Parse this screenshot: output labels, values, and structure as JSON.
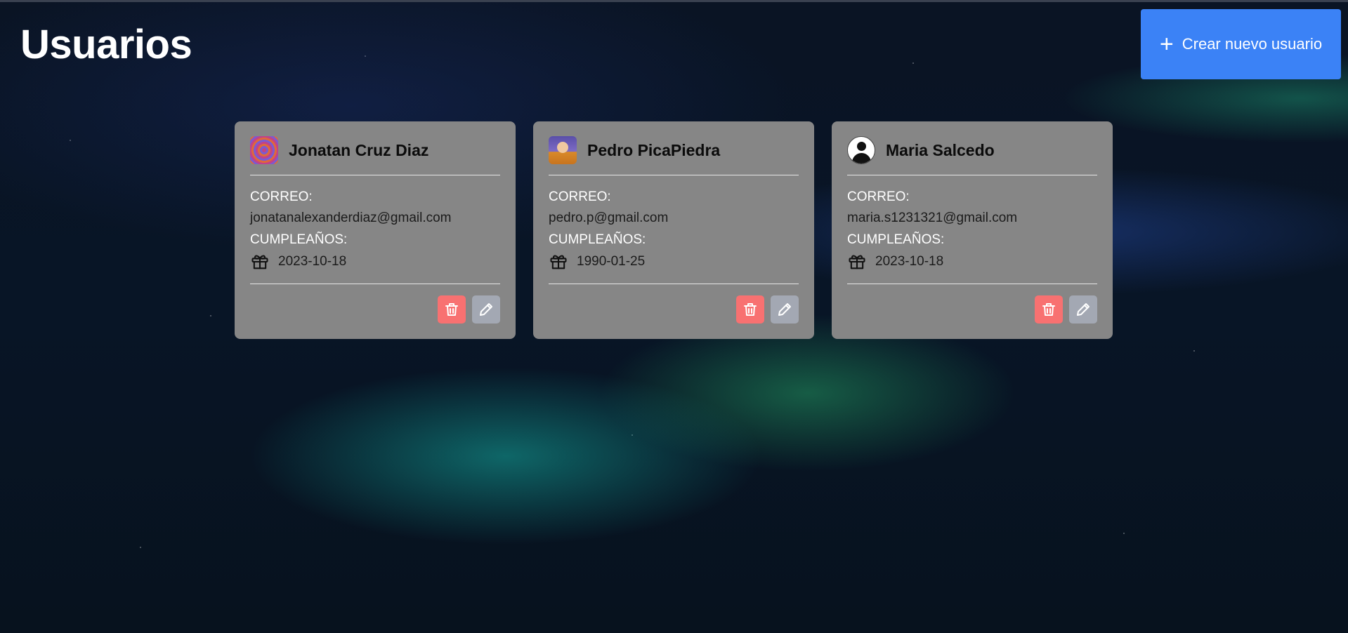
{
  "header": {
    "title": "Usuarios",
    "create_button_label": "Crear nuevo usuario"
  },
  "labels": {
    "email": "CORREO:",
    "birthday": "CUMPLEAÑOS:"
  },
  "users": [
    {
      "name": "Jonatan Cruz Diaz",
      "email": "jonatanalexanderdiaz@gmail.com",
      "birthday": "2023-10-18",
      "avatar": "psychedelic-pattern-avatar"
    },
    {
      "name": "Pedro PicaPiedra",
      "email": "pedro.p@gmail.com",
      "birthday": "1990-01-25",
      "avatar": "cartoon-character-avatar"
    },
    {
      "name": "Maria Salcedo",
      "email": "maria.s1231321@gmail.com",
      "birthday": "2023-10-18",
      "avatar": "default-user-avatar"
    }
  ],
  "icons": {
    "create": "plus-icon",
    "birthday": "gift-icon",
    "delete": "trash-icon",
    "edit": "pencil-icon"
  },
  "colors": {
    "primary_button": "#3b82f6",
    "delete_button": "#f87171",
    "edit_button": "#a3a8b3",
    "card_background": "#868686"
  }
}
